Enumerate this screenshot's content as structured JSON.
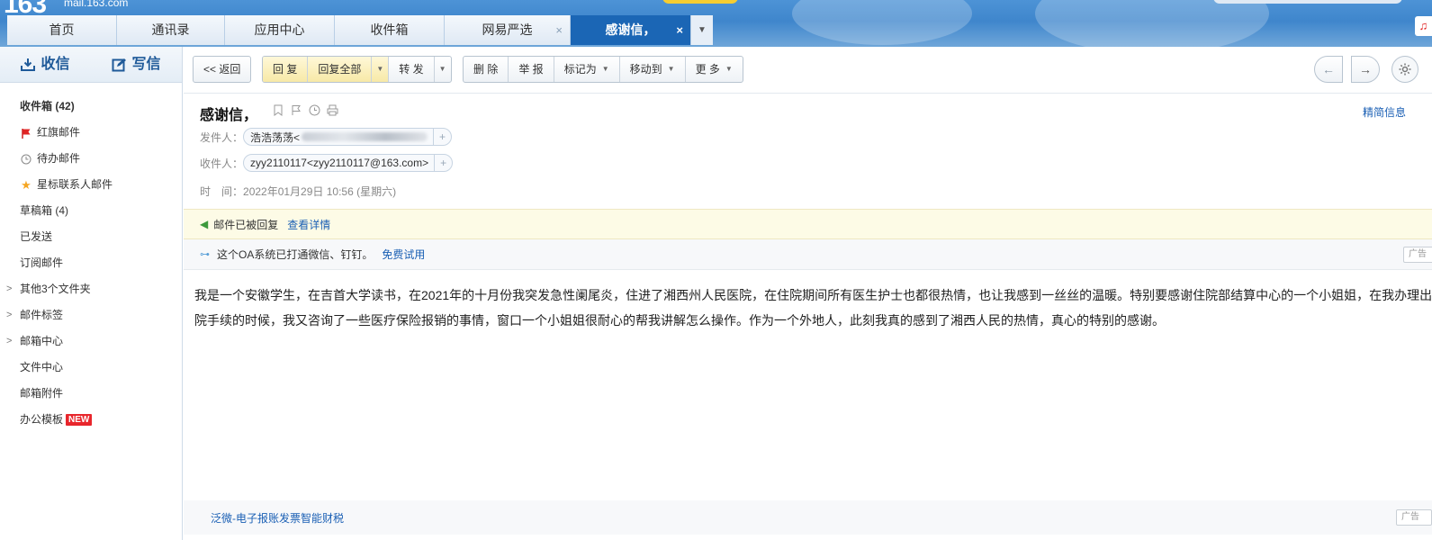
{
  "banner": {
    "logo_text": "163",
    "logo_domain": "mail.163.com"
  },
  "tabs": [
    {
      "label": "首页"
    },
    {
      "label": "通讯录"
    },
    {
      "label": "应用中心"
    },
    {
      "label": "收件箱"
    },
    {
      "label": "网易严选",
      "close": "×"
    },
    {
      "label": "感谢信，",
      "close": "×",
      "active": true
    }
  ],
  "sidebar": {
    "receive_label": "收信",
    "compose_label": "写信",
    "items": [
      {
        "label": "收件箱",
        "count": "(42)"
      },
      {
        "label": "红旗邮件",
        "icon": "red-flag-icon"
      },
      {
        "label": "待办邮件",
        "icon": "clock-icon"
      },
      {
        "label": "星标联系人邮件",
        "icon": "star-icon"
      },
      {
        "label": "草稿箱 (4)"
      },
      {
        "label": "已发送"
      },
      {
        "label": "订阅邮件"
      },
      {
        "label": "其他3个文件夹",
        "caret": ">"
      },
      {
        "label": "邮件标签",
        "caret": ">"
      },
      {
        "label": "邮箱中心",
        "caret": ">"
      },
      {
        "label": "文件中心"
      },
      {
        "label": "邮箱附件"
      },
      {
        "label": "办公模板",
        "badge": "NEW"
      }
    ]
  },
  "toolbar": {
    "back": "<< 返回",
    "reply": "回 复",
    "reply_all": "回复全部",
    "forward": "转 发",
    "delete": "删 除",
    "report": "举 报",
    "mark_as": "标记为",
    "move_to": "移动到",
    "more": "更 多",
    "prev_arrow": "←",
    "next_arrow": "→"
  },
  "email": {
    "subject": "感谢信，",
    "brief_info": "精简信息",
    "sender_label": "发件人：",
    "sender_name": "浩浩荡荡<",
    "recipient_label": "收件人：",
    "recipient": "zyy2110117<zyy2110117@163.com>",
    "time_label": "时　间：",
    "time": "2022年01月29日 10:56 (星期六)",
    "replied_text": "邮件已被回复",
    "replied_detail": "查看详情",
    "body": "我是一个安徽学生，在吉首大学读书，在2021年的十月份我突发急性阑尾炎，住进了湘西州人民医院，在住院期间所有医生护士也都很热情，也让我感到一丝丝的温暖。特别要感谢住院部结算中心的一个小姐姐，在我办理出院手续的时候，我又咨询了一些医疗保险报销的事情，窗口一个小姐姐很耐心的帮我讲解怎么操作。作为一个外地人，此刻我真的感到了湘西人民的热情，真心的特别的感谢。"
  },
  "ads": {
    "top_text": "这个OA系统已打通微信、钉钉。",
    "top_link": "免费试用",
    "tag": "广告",
    "bottom_text": "泛微-电子报账发票智能财税"
  },
  "colors": {
    "banner": "#3f86cc",
    "active_tab": "#1b66b5",
    "link": "#1a5fb4",
    "new_badge": "#e8262c"
  }
}
